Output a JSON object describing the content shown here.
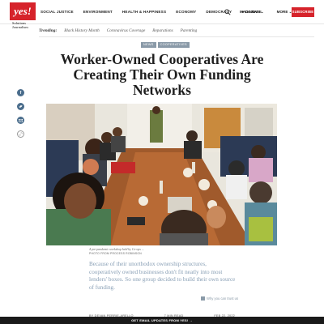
{
  "header": {
    "logo_text": "yes!",
    "logo_sub": "Solutions Journalism",
    "nav": [
      "SOCIAL JUSTICE",
      "ENVIRONMENT",
      "HEALTH & HAPPINESS",
      "ECONOMY",
      "DEMOCRACY"
    ],
    "donate_label": "DONATE",
    "right_nav": [
      "MAGAZINE ⌄",
      "MORE ⌄"
    ],
    "subscribe_label": "SUBSCRIBE"
  },
  "trending": {
    "label": "Trending:",
    "items": [
      "Black History Month",
      "Coronavirus Coverage",
      "Reparations",
      "Parenting"
    ]
  },
  "tags": [
    "NEWS",
    "COOPERATIVES"
  ],
  "article": {
    "title": "Worker-Owned Cooperatives Are Creating Their Own Funding Networks",
    "photo_caption": "A pre-pandemic workshop held by Co-ops ...",
    "photo_credit": "PHOTO FROM PROCESS ROBINSON",
    "dek": "Because of their unorthodox ownership structures, cooperatively owned businesses don't fit neatly into most lenders' boxes. So one group decided to build their own source of funding.",
    "why_label": "Why you can trust us",
    "byline_author": "BY DEVAN PERRIE-ARELLO",
    "byline_read": "7 MIN READ",
    "byline_date": "FEB 22, 2022"
  },
  "footer_bar": "GET EMAIL UPDATES FROM YES! →",
  "colors": {
    "brand_red": "#d6232b",
    "tag_gray": "#8a9aa8",
    "social_blue": "#4a6d8c",
    "dek_blue": "#8aa0b6"
  },
  "icons": [
    "facebook-icon",
    "twitter-icon",
    "email-icon",
    "link-icon",
    "search-icon",
    "heart-icon"
  ]
}
